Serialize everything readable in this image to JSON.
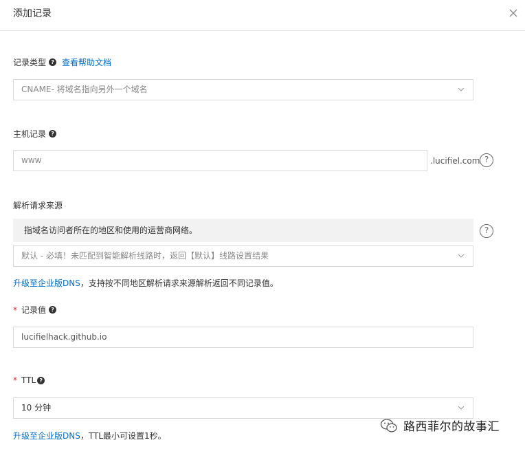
{
  "dialog": {
    "title": "添加记录"
  },
  "record_type": {
    "label": "记录类型",
    "help_link": "查看帮助文档",
    "selected": "CNAME- 将域名指向另外一个域名"
  },
  "host": {
    "label": "主机记录",
    "placeholder": "www",
    "suffix": ".lucifiel.com"
  },
  "resolve_source": {
    "label": "解析请求来源",
    "info": "指域名访问者所在的地区和使用的运营商网络。",
    "selected": "默认 - 必填！未匹配到智能解析线路时，返回【默认】线路设置结果",
    "upgrade_link": "升级至企业版DNS",
    "upgrade_text": "，支持按不同地区解析请求来源解析返回不同记录值。"
  },
  "record_value": {
    "required_mark": "*",
    "label": "记录值",
    "value": "lucifielhack.github.io"
  },
  "ttl": {
    "required_mark": "*",
    "label": "TTL",
    "selected": "10 分钟",
    "upgrade_link": "升级至企业版DNS",
    "upgrade_text": "，TTL最小可设置1秒。"
  },
  "watermark": {
    "text": "路西菲尔的故事汇"
  },
  "icons": {
    "help": "?",
    "close": "close-icon",
    "chevron": "chevron-down-icon"
  }
}
